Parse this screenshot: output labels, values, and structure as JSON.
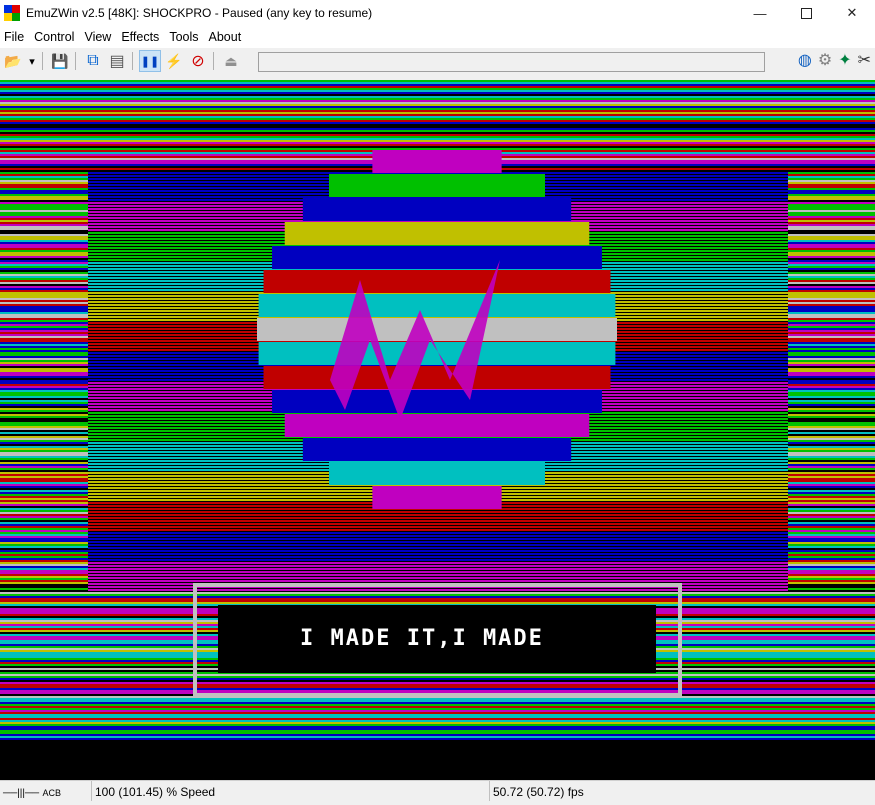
{
  "window": {
    "title": "EmuZWin v2.5 [48K]: SHOCKPRO - Paused (any key to resume)",
    "controls": {
      "minimize": "—",
      "close": "✕"
    }
  },
  "menu": [
    "File",
    "Control",
    "View",
    "Effects",
    "Tools",
    "About"
  ],
  "toolbar": {
    "left_icons": [
      "open-folder-icon",
      "dropdown-arrow-icon",
      "save-disk-icon",
      "snapshot-icon",
      "tape-icon",
      "pause-icon",
      "turbo-lightning-icon",
      "no-effects-icon",
      "play-tape-icon"
    ],
    "right_icons": [
      "globe-icon",
      "settings-gear-icon",
      "compass-icon",
      "tools-icon"
    ],
    "glyphs": {
      "open": "📂",
      "dropdown": "▾",
      "save": "💾",
      "snapshot": "⧉",
      "tape": "▤",
      "pause": "❚❚",
      "turbo": "⚡",
      "noeffects": "⊘",
      "playtape": "⏏",
      "globe": "◍",
      "gear": "⚙",
      "compass": "✦",
      "tools": "✂"
    }
  },
  "screen": {
    "banner_text": "I MADE IT,I MADE"
  },
  "status": {
    "tape_indicator": "ACB",
    "speed": "100 (101.45) % Speed",
    "fps": "50.72 (50.72) fps"
  },
  "colors": {
    "zx_black": "#000000",
    "zx_blue": "#0000c0",
    "zx_red": "#c00000",
    "zx_magenta": "#c000c0",
    "zx_green": "#00c000",
    "zx_cyan": "#00c0c0",
    "zx_yellow": "#c0c000",
    "zx_white": "#c0c0c0",
    "zx_bright_white": "#ffffff"
  }
}
